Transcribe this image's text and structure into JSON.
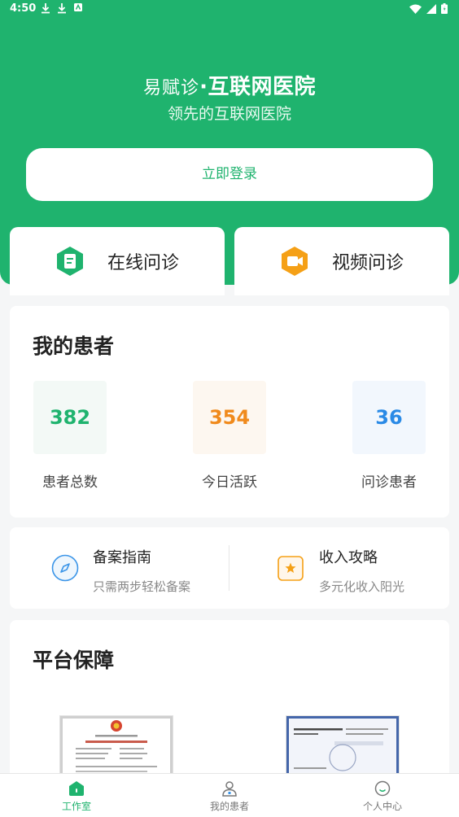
{
  "status_bar": {
    "time": "4:50"
  },
  "header": {
    "brand_logo": "易赋诊",
    "brand_title": "·互联网医院",
    "slogan": "领先的互联网医院",
    "login_label": "立即登录"
  },
  "consult": {
    "online_label": "在线问诊",
    "video_label": "视频问诊"
  },
  "patients": {
    "title": "我的患者",
    "stats": [
      {
        "value": "382",
        "label": "患者总数",
        "color": "#1fb36e",
        "bg": "#f3f9f6"
      },
      {
        "value": "354",
        "label": "今日活跃",
        "color": "#f08a1c",
        "bg": "#fdf7f0"
      },
      {
        "value": "36",
        "label": "问诊患者",
        "color": "#2a8ae6",
        "bg": "#f2f7fd"
      }
    ]
  },
  "guides": [
    {
      "title": "备案指南",
      "subtitle": "只需两步轻松备案",
      "icon": "compass-icon"
    },
    {
      "title": "收入攻略",
      "subtitle": "多元化收入阳光",
      "icon": "star-badge-icon"
    }
  ],
  "platform": {
    "title": "平台保障"
  },
  "tabbar": {
    "items": [
      {
        "label": "工作室",
        "icon": "home-icon",
        "active": true
      },
      {
        "label": "我的患者",
        "icon": "patient-icon",
        "active": false
      },
      {
        "label": "个人中心",
        "icon": "smile-icon",
        "active": false
      }
    ],
    "active_color": "#1fb36e"
  },
  "colors": {
    "brand": "#1fb36e",
    "background": "#f5f6f7"
  }
}
